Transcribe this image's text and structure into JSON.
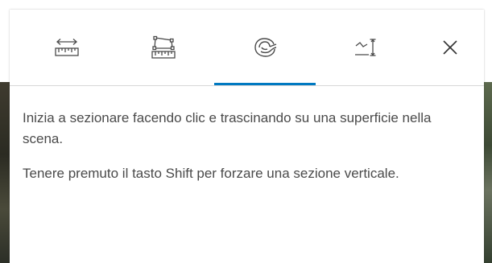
{
  "theme": {
    "accent": "#0079c1",
    "icon_color": "#4a4a4a",
    "text_color": "#4a4a4a"
  },
  "toolbar": {
    "tools": [
      {
        "icon": "distance-measure-icon",
        "active": false
      },
      {
        "icon": "area-measure-icon",
        "active": false
      },
      {
        "icon": "slice-icon",
        "active": true
      },
      {
        "icon": "elevation-profile-icon",
        "active": false
      }
    ],
    "close_icon": "close-icon"
  },
  "content": {
    "instruction_1": "Inizia a sezionare facendo clic e trascinando su una superficie nella scena.",
    "instruction_2": "Tenere premuto il tasto Shift per forzare una sezione verticale."
  }
}
